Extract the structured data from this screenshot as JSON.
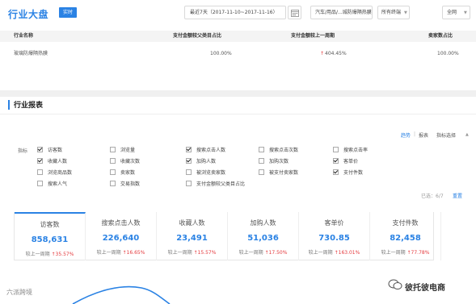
{
  "header": {
    "title": "行业大盘",
    "badge": "实时",
    "date_range": "最近7天（2017-11-10~2017-11-16）",
    "category": "汽车/用品/...城防爆隔热膜",
    "terminal": "所有终端",
    "network": "全网"
  },
  "summary": {
    "headers": [
      "行业名称",
      "支付金额较父类目占比",
      "支付金额较上一周期",
      "卖家数占比"
    ],
    "row": {
      "name": "玻璃防爆隔热膜",
      "parent_share": "100.00%",
      "prev_period": "404.45%",
      "seller_share": "100.00%"
    }
  },
  "report": {
    "title": "行业报表",
    "toolbar": {
      "trend": "趋势",
      "sep": "|",
      "table": "报表",
      "pick": "指标选择"
    },
    "metrics_label": "指标",
    "checkboxes": [
      {
        "label": "访客数",
        "checked": true
      },
      {
        "label": "浏览量",
        "checked": false
      },
      {
        "label": "搜索点击人数",
        "checked": true
      },
      {
        "label": "搜索点击次数",
        "checked": false
      },
      {
        "label": "搜索点击率",
        "checked": false
      },
      {
        "label": "收藏人数",
        "checked": true
      },
      {
        "label": "收藏次数",
        "checked": false
      },
      {
        "label": "加购人数",
        "checked": true
      },
      {
        "label": "加购次数",
        "checked": false
      },
      {
        "label": "客单价",
        "checked": true
      },
      {
        "label": "浏览商品数",
        "checked": false
      },
      {
        "label": "卖家数",
        "checked": false
      },
      {
        "label": "被浏览卖家数",
        "checked": false
      },
      {
        "label": "被支付卖家数",
        "checked": false
      },
      {
        "label": "支付件数",
        "checked": true
      },
      {
        "label": "搜索人气",
        "checked": false
      },
      {
        "label": "交易指数",
        "checked": false
      },
      {
        "label": "支付金额较父类目占比",
        "checked": false
      }
    ],
    "selected_info": "已选：6/7",
    "reset": "重置"
  },
  "kpis": [
    {
      "name": "访客数",
      "value": "858,631",
      "cmp_label": "较上一周期",
      "change": "35.57%",
      "dir": "up"
    },
    {
      "name": "搜索点击人数",
      "value": "226,640",
      "cmp_label": "较上一周期",
      "change": "16.65%",
      "dir": "up"
    },
    {
      "name": "收藏人数",
      "value": "23,491",
      "cmp_label": "较上一周期",
      "change": "15.57%",
      "dir": "up"
    },
    {
      "name": "加购人数",
      "value": "51,036",
      "cmp_label": "较上一周期",
      "change": "17.50%",
      "dir": "up"
    },
    {
      "name": "客单价",
      "value": "730.85",
      "cmp_label": "较上一周期",
      "change": "163.01%",
      "dir": "up"
    },
    {
      "name": "支付件数",
      "value": "82,458",
      "cmp_label": "较上一周期",
      "change": "77.78%",
      "dir": "up"
    }
  ],
  "watermarks": {
    "left": "六派跨境",
    "right": "彼托彼电商"
  },
  "colors": {
    "accent": "#2a82e4",
    "up": "#e4393c",
    "down": "#1aa35b"
  }
}
